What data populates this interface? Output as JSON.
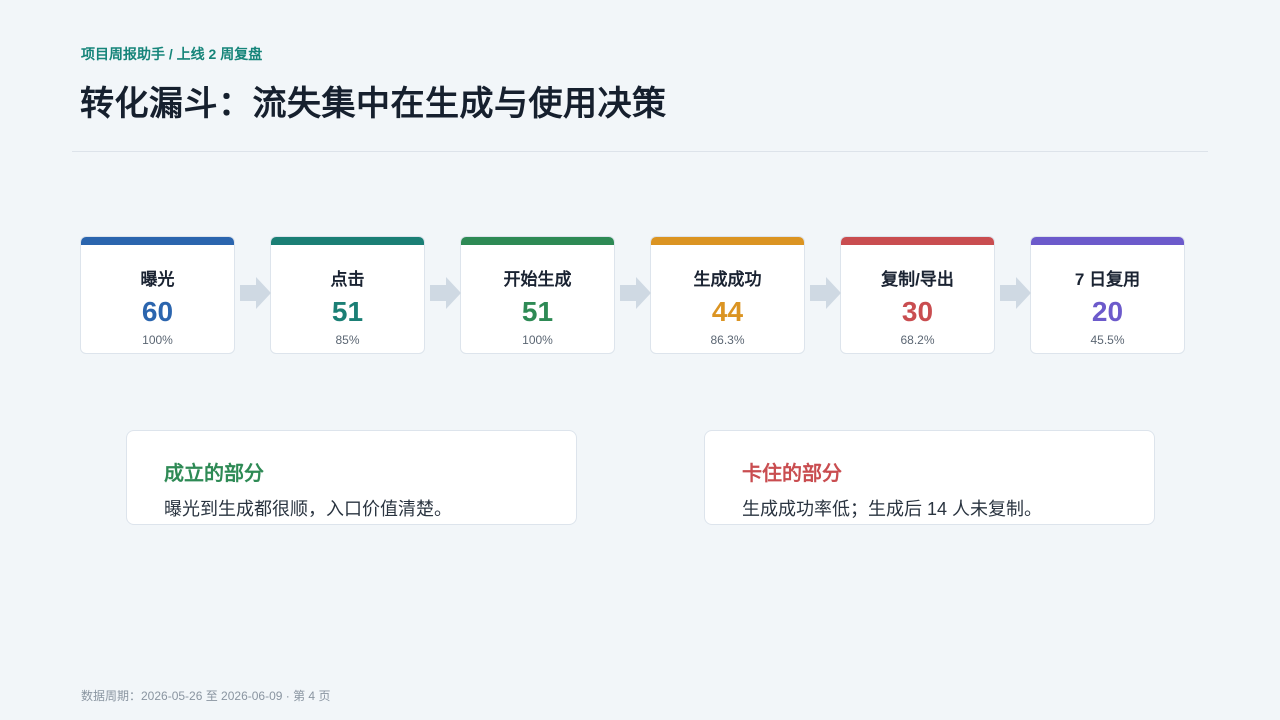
{
  "header": {
    "breadcrumb": "项目周报助手 / 上线 2 周复盘",
    "title": "转化漏斗：流失集中在生成与使用决策"
  },
  "funnel": {
    "steps": [
      {
        "label": "曝光",
        "value": "60",
        "pct": "100%",
        "color": "#2b65ae"
      },
      {
        "label": "点击",
        "value": "51",
        "pct": "85%",
        "color": "#1b7f75"
      },
      {
        "label": "开始生成",
        "value": "51",
        "pct": "100%",
        "color": "#2e8a55"
      },
      {
        "label": "生成成功",
        "value": "44",
        "pct": "86.3%",
        "color": "#db9422"
      },
      {
        "label": "复制/导出",
        "value": "30",
        "pct": "68.2%",
        "color": "#c94d50"
      },
      {
        "label": "7 日复用",
        "value": "20",
        "pct": "45.5%",
        "color": "#6c5acb"
      }
    ],
    "arrow_color": "#cfd9e3"
  },
  "cards": {
    "works": {
      "title": "成立的部分",
      "body": "曝光到生成都很顺，入口价值清楚。",
      "color": "#2e8a55"
    },
    "stuck": {
      "title": "卡住的部分",
      "body": "生成成功率低；生成后 14 人未复制。",
      "color": "#c94d50"
    }
  },
  "footer": {
    "text": "数据周期：2026-05-26 至 2026-06-09 · 第 4 页"
  }
}
